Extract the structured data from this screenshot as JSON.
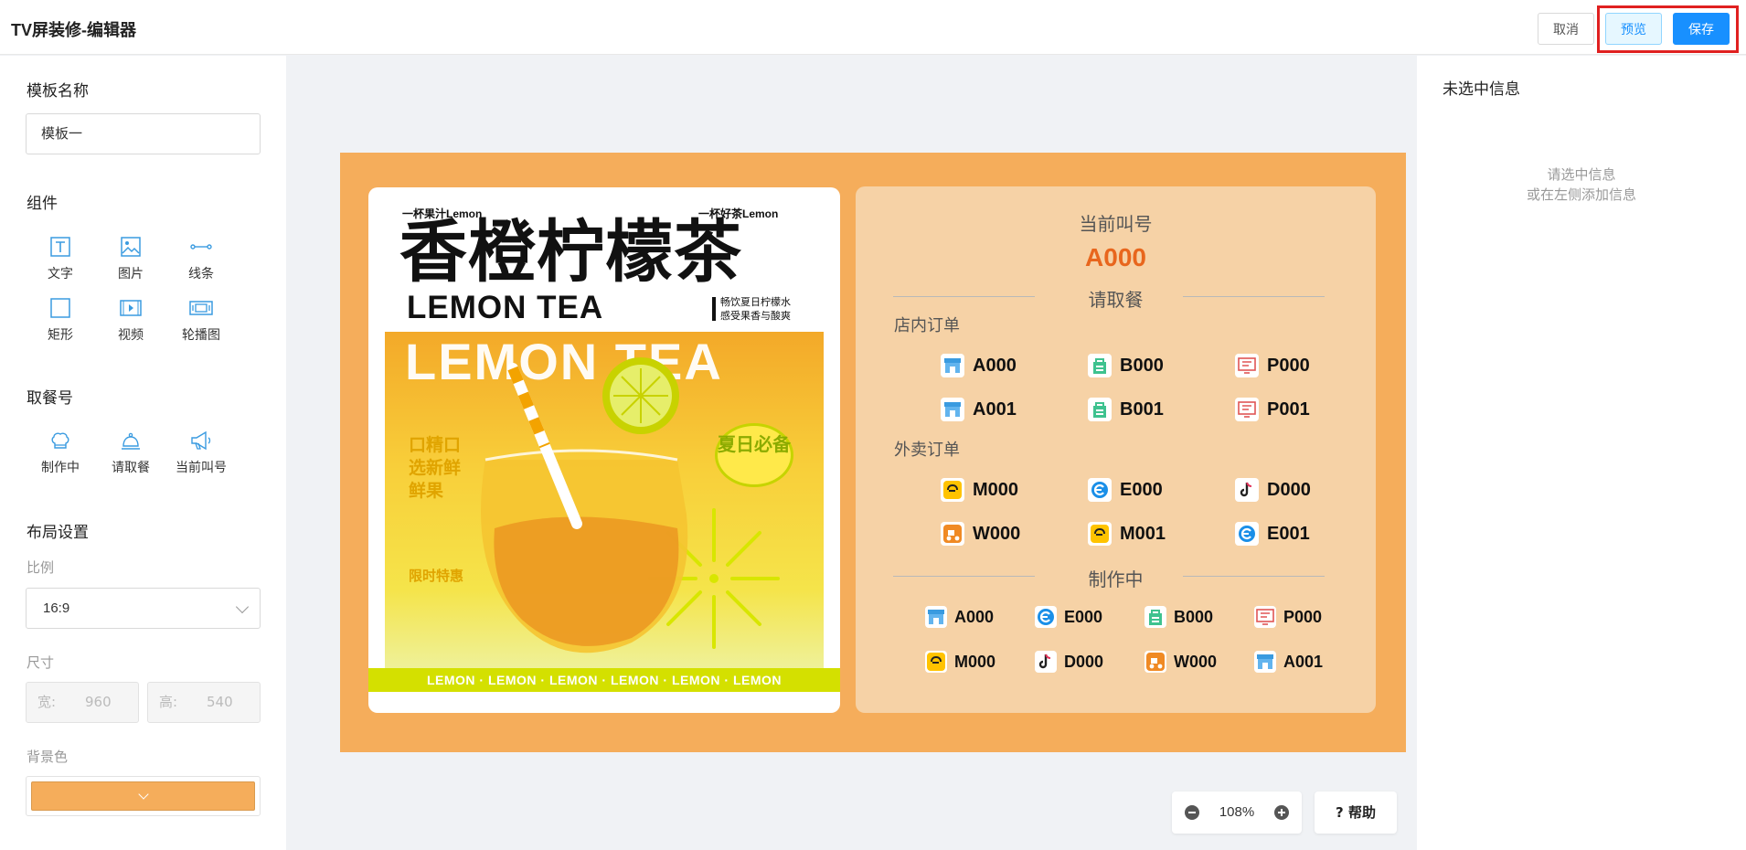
{
  "header": {
    "title": "TV屏装修-编辑器",
    "cancel_label": "取消",
    "preview_label": "预览",
    "save_label": "保存"
  },
  "left": {
    "template_name_title": "模板名称",
    "template_name_value": "模板一",
    "components_title": "组件",
    "components": [
      {
        "label": "文字",
        "icon": "text-icon"
      },
      {
        "label": "图片",
        "icon": "image-icon"
      },
      {
        "label": "线条",
        "icon": "line-icon"
      },
      {
        "label": "矩形",
        "icon": "rectangle-icon"
      },
      {
        "label": "视频",
        "icon": "video-icon"
      },
      {
        "label": "轮播图",
        "icon": "carousel-icon"
      }
    ],
    "pickup_title": "取餐号",
    "pickup_components": [
      {
        "label": "制作中",
        "icon": "chef-hat-icon"
      },
      {
        "label": "请取餐",
        "icon": "bell-icon"
      },
      {
        "label": "当前叫号",
        "icon": "megaphone-icon"
      }
    ],
    "layout_title": "布局设置",
    "ratio_label": "比例",
    "ratio_value": "16:9",
    "size_label": "尺寸",
    "width_label": "宽:",
    "width_value": "960",
    "height_label": "高:",
    "height_value": "540",
    "bg_label": "背景色",
    "bg_color": "#f5ad5b"
  },
  "right": {
    "title": "未选中信息",
    "hint_line1": "请选中信息",
    "hint_line2": "或在左侧添加信息"
  },
  "poster": {
    "tag_left": "一杯果汁Lemon",
    "tag_right": "一杯好茶Lemon",
    "title": "香橙柠檬茶",
    "subtitle": "LEMON TEA",
    "note_line1": "畅饮夏日柠檬水",
    "note_line2": "感受果香与酸爽",
    "big_text": "LEMON TEA",
    "side_text": "口精口选新鲜鲜果",
    "limited": "限时特惠",
    "badge": "夏日必备",
    "strip": "LEMON · LEMON · LEMON · LEMON · LEMON · LEMON"
  },
  "board": {
    "current_call_label": "当前叫号",
    "current_call_number": "A000",
    "pickup_label": "请取餐",
    "dine_in_label": "店内订单",
    "dine_in": [
      {
        "icon": "store-icon",
        "number": "A000"
      },
      {
        "icon": "bag-icon",
        "number": "B000"
      },
      {
        "icon": "screen-icon",
        "number": "P000"
      },
      {
        "icon": "store-icon",
        "number": "A001"
      },
      {
        "icon": "bag-icon",
        "number": "B001"
      },
      {
        "icon": "screen-icon",
        "number": "P001"
      }
    ],
    "delivery_label": "外卖订单",
    "delivery": [
      {
        "icon": "meituan-icon",
        "number": "M000"
      },
      {
        "icon": "eleme-icon",
        "number": "E000"
      },
      {
        "icon": "douyin-icon",
        "number": "D000"
      },
      {
        "icon": "scooter-icon",
        "number": "W000"
      },
      {
        "icon": "meituan-icon",
        "number": "M001"
      },
      {
        "icon": "eleme-icon",
        "number": "E001"
      }
    ],
    "making_label": "制作中",
    "making": [
      {
        "icon": "store-icon",
        "number": "A000"
      },
      {
        "icon": "eleme-icon",
        "number": "E000"
      },
      {
        "icon": "bag-icon",
        "number": "B000"
      },
      {
        "icon": "screen-icon",
        "number": "P000"
      },
      {
        "icon": "meituan-icon",
        "number": "M000"
      },
      {
        "icon": "douyin-icon",
        "number": "D000"
      },
      {
        "icon": "scooter-icon",
        "number": "W000"
      },
      {
        "icon": "store-icon",
        "number": "A001"
      }
    ]
  },
  "zoom": {
    "value": "108%",
    "help_label": "? 帮助"
  },
  "colors": {
    "accent": "#1890ff",
    "canvas_bg": "#f5ad5b",
    "board_bg": "#f6d2a6",
    "call_number": "#e8661d",
    "highlight": "#e02020"
  }
}
